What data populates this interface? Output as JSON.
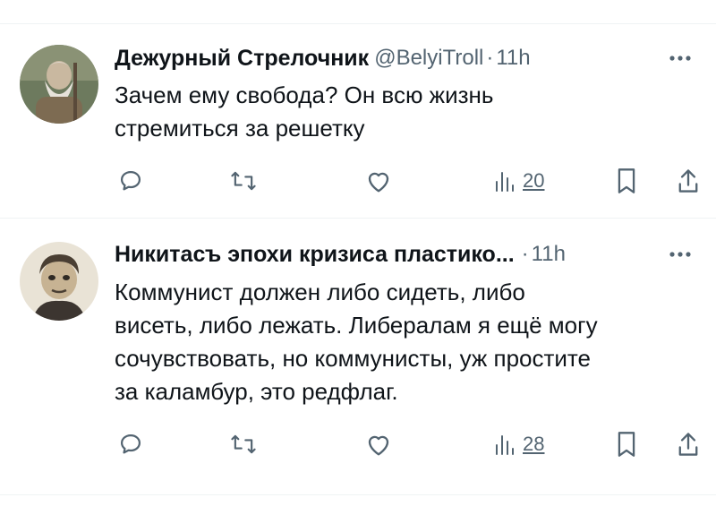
{
  "tweets": [
    {
      "author_name": "Дежурный Стрелочник",
      "handle": "@BelyiTroll",
      "separator": "·",
      "time": "11h",
      "text_lines": [
        "Зачем ему свобода? Он всю жизнь",
        "стремиться за решетку"
      ],
      "views": "20",
      "avatar_icon": "avatar-old-man-painting"
    },
    {
      "author_name": "Никитасъ эпохи кризиса пластико...",
      "handle": "",
      "separator": "·",
      "time": "11h",
      "text_lines": [
        "Коммунист должен либо сидеть, либо",
        "висеть, либо лежать. Либералам я ещё могу",
        "сочувствовать, но коммунисты, уж простите",
        "за каламбур, это редфлаг."
      ],
      "views": "28",
      "avatar_icon": "avatar-caricature-portrait"
    }
  ],
  "icons": {
    "reply": "reply-icon",
    "retweet": "retweet-icon",
    "like": "like-icon",
    "views": "views-icon",
    "bookmark": "bookmark-icon",
    "share": "share-icon",
    "more": "more-icon"
  },
  "colors": {
    "text": "#0f1419",
    "secondary": "#536471",
    "divider": "#eff3f4"
  }
}
